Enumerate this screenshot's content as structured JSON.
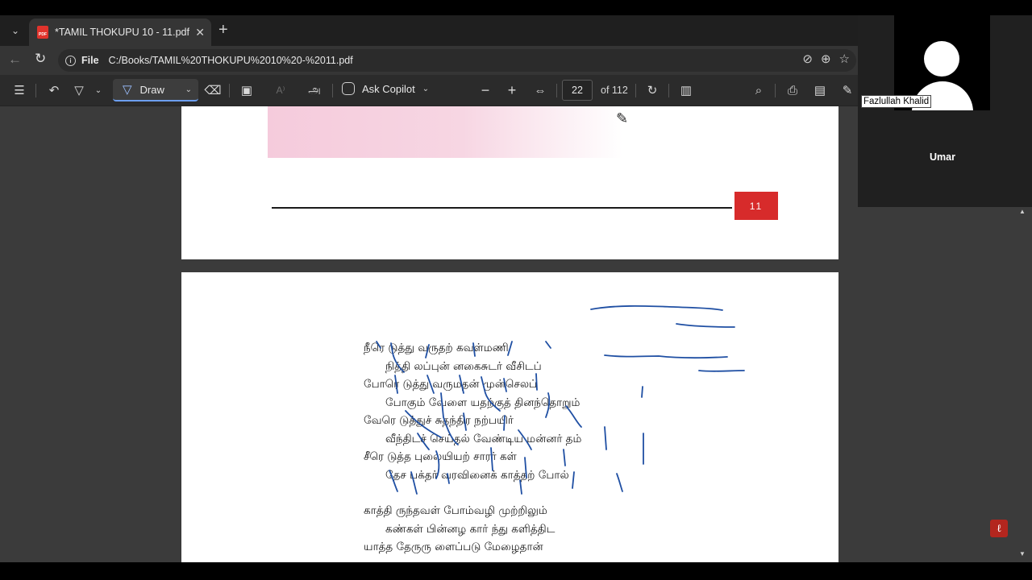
{
  "browser": {
    "tab_title": "*TAMIL THOKUPU 10 - 11.pdf",
    "url_scheme": "File",
    "url": "C:/Books/TAMIL%20THOKUPU%2010%20-%2011.pdf"
  },
  "toolbar": {
    "draw_label": "Draw",
    "text_tool_label": "அ",
    "copilot_label": "Ask Copilot",
    "current_page": "22",
    "page_count_label": "of 112"
  },
  "document": {
    "page_number_badge": "11",
    "poem_lines": [
      "நீரெ டுத்து வருதற் கவள்மணி",
      "நித்தி லப்புன் னகைசுடர் வீசிடப்",
      "போரெ டுத்து வருமதன் முன்செலப்",
      "போகும் வேளை யதற்குத் தினந்தொறும்",
      "வேரெ டுத்துச் சுதந்திர நற்பயிர்",
      "வீந்திடச் செய்தல் வேண்டிய மன்னர் தம்",
      "சீரெ டுத்த புலையியற் சாரர் கள்",
      "தேச பக்தர் வரவினைக் காத்தற் போல்",
      "காத்தி ருந்தவள் போம்வழி முற்றிலும்",
      "கண்கள் பின்னழ கார் ந்து களித்திட",
      "யாத்த தேருரு ளைப்படு மேழைதான்"
    ]
  },
  "call": {
    "participant_1": "Fazlullah Khalid",
    "participant_2": "Umar"
  },
  "colors": {
    "ink": "#1f4fa3",
    "badge": "#d72b2b",
    "accent": "#6c9ff0"
  }
}
